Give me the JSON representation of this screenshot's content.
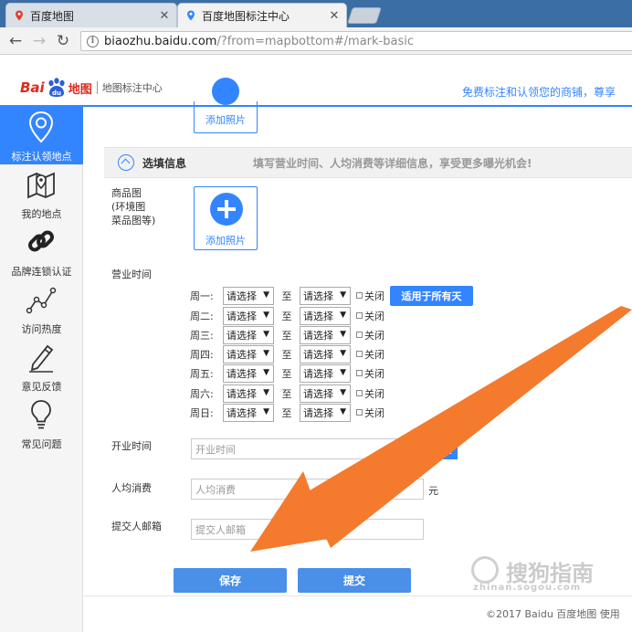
{
  "browser": {
    "tabs": [
      {
        "title": "百度地图",
        "active": false
      },
      {
        "title": "百度地图标注中心",
        "active": true
      }
    ],
    "address": {
      "host": "biaozhu.baidu.com",
      "path": "/?from=mapbottom#/mark-basic"
    }
  },
  "header": {
    "logo_bai": "Bai",
    "logo_du": "du",
    "logo_tu": "地图",
    "logo_sub": "地图标注中心",
    "promo": "免费标注和认领您的商铺，尊享"
  },
  "sidebar": {
    "items": [
      {
        "label": "标注认领地点",
        "icon": "location-pin-icon",
        "active": true
      },
      {
        "label": "我的地点",
        "icon": "map-fold-icon",
        "active": false
      },
      {
        "label": "品牌连锁认证",
        "icon": "chain-link-icon",
        "active": false
      },
      {
        "label": "访问热度",
        "icon": "line-trend-icon",
        "active": false
      },
      {
        "label": "意见反馈",
        "icon": "pencil-icon",
        "active": false
      },
      {
        "label": "常见问题",
        "icon": "lightbulb-icon",
        "active": false
      }
    ]
  },
  "form": {
    "add_photo_label": "添加照片",
    "section_title": "选填信息",
    "section_desc": "填写营业时间、人均消费等详细信息，享受更多曝光机会!",
    "product_label": "商品图\n(环境图\n菜品图等)",
    "hours_label": "营业时间",
    "days": [
      "周一:",
      "周二:",
      "周三:",
      "周四:",
      "周五:",
      "周六:",
      "周日:"
    ],
    "select_placeholder": "请选择",
    "to_label": "至",
    "closed_label": "关闭",
    "apply_all": "适用于所有天",
    "open_time_label": "开业时间",
    "open_time_placeholder": "开业时间",
    "clear_btn": "清空",
    "avg_label": "人均消费",
    "avg_placeholder": "人均消费",
    "avg_unit": "元",
    "email_label": "提交人邮箱",
    "email_placeholder": "提交人邮箱",
    "save_btn": "保存",
    "submit_btn": "提交"
  },
  "footer": {
    "copyright": "©2017 Baidu  百度地图   使用"
  },
  "watermark": {
    "text": "搜狗指南",
    "sub": "zhinan.sogou.com"
  },
  "colors": {
    "accent": "#3385ff",
    "arrow": "#f47a2d",
    "tabbar": "#3b6ea5"
  }
}
